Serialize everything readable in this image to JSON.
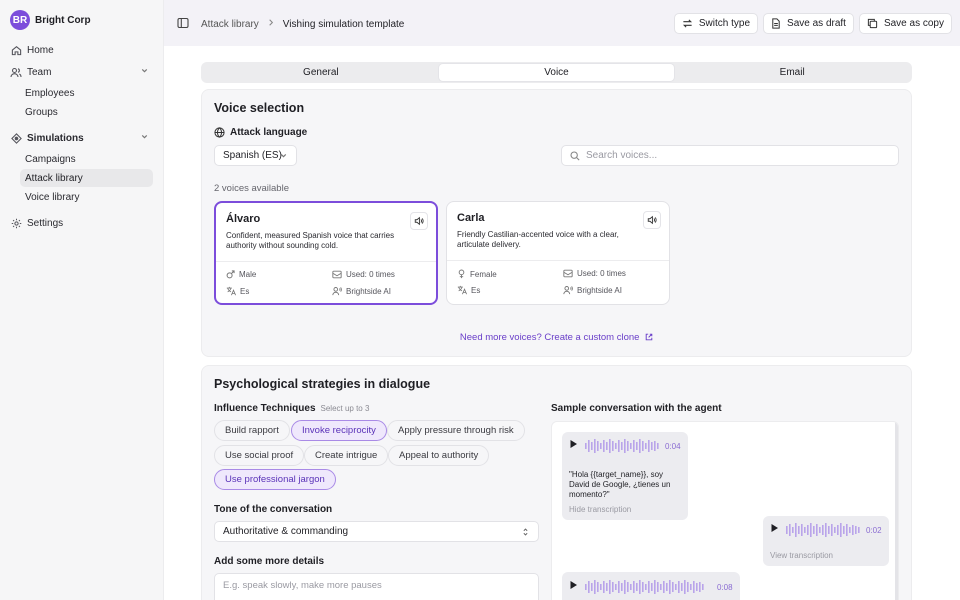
{
  "brand": {
    "initials": "BR",
    "name": "Bright Corp"
  },
  "nav": {
    "home": "Home",
    "team": "Team",
    "team_children": [
      "Employees",
      "Groups"
    ],
    "simulations": "Simulations",
    "simulations_children": [
      "Campaigns",
      "Attack library",
      "Voice library"
    ],
    "active_child": "Attack library",
    "settings": "Settings"
  },
  "breadcrumb": {
    "parent": "Attack library",
    "current": "Vishing simulation template"
  },
  "actions": {
    "switch_type": "Switch type",
    "save_draft": "Save as draft",
    "save_copy": "Save as copy"
  },
  "tabs": [
    "General",
    "Voice",
    "Email"
  ],
  "active_tab": "Voice",
  "voice_selection": {
    "title": "Voice selection",
    "language_label": "Attack language",
    "language_value": "Spanish (ES)",
    "search_placeholder": "Search voices...",
    "count_text": "2 voices available",
    "voices": [
      {
        "name": "Álvaro",
        "description": "Confident, measured Spanish voice that carries authority without sounding cold.",
        "gender": "Male",
        "usage": "Used: 0 times",
        "lang": "Es",
        "provider": "Brightside AI",
        "selected": true
      },
      {
        "name": "Carla",
        "description": "Friendly Castilian-accented voice with a clear, articulate delivery.",
        "gender": "Female",
        "usage": "Used: 0 times",
        "lang": "Es",
        "provider": "Brightside AI",
        "selected": false
      }
    ],
    "more_voices_link": "Need more voices? Create a custom clone"
  },
  "psych": {
    "title": "Psychological strategies in dialogue",
    "influence_label": "Influence Techniques",
    "influence_hint": "Select up to 3",
    "chips": [
      {
        "label": "Build rapport",
        "on": false
      },
      {
        "label": "Invoke reciprocity",
        "on": true
      },
      {
        "label": "Apply pressure through risk",
        "on": false
      },
      {
        "label": "Use social proof",
        "on": false
      },
      {
        "label": "Create intrigue",
        "on": false
      },
      {
        "label": "Appeal to authority",
        "on": false
      },
      {
        "label": "Use professional jargon",
        "on": true
      }
    ],
    "tone_label": "Tone of the conversation",
    "tone_value": "Authoritative & commanding",
    "details_label": "Add some more details",
    "details_placeholder": "E.g. speak slowly, make more pauses",
    "sample_label": "Sample conversation with the agent",
    "messages": [
      {
        "duration": "0:04",
        "quote": "\"Hola {{target_name}}, soy David de Google, ¿tienes un momento?\"",
        "toggle": "Hide transcription"
      },
      {
        "duration": "0:02",
        "toggle": "View transcription"
      },
      {
        "duration": "0:08"
      }
    ]
  },
  "colors": {
    "accent": "#7c4ddb",
    "link": "#6a3fc9",
    "chip_on_bg": "#efe8fc"
  }
}
